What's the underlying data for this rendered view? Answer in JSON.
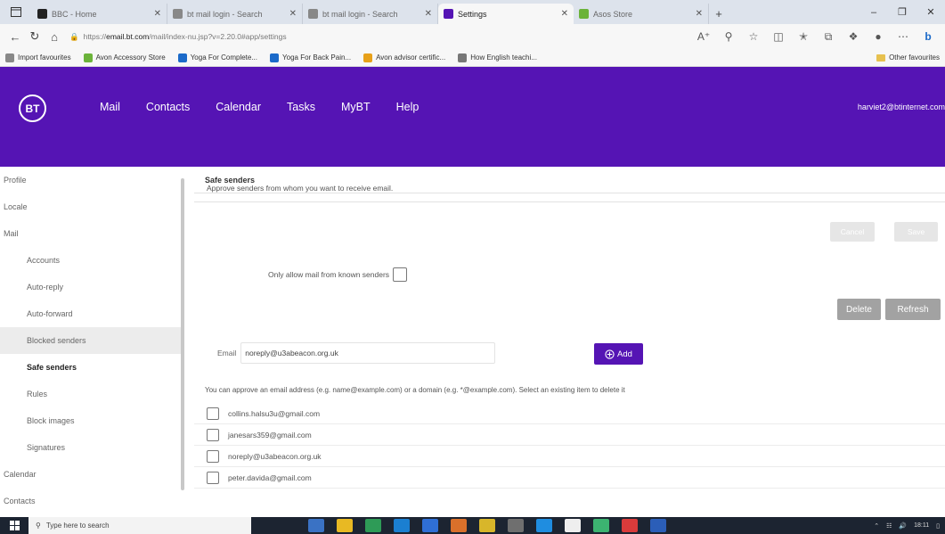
{
  "browser": {
    "tabs": [
      {
        "title": "BBC - Home",
        "fav_color": "#222222",
        "active": false
      },
      {
        "title": "bt mail login - Search",
        "fav_color": "#888888",
        "active": false
      },
      {
        "title": "bt mail login - Search",
        "fav_color": "#888888",
        "active": false
      },
      {
        "title": "Settings",
        "fav_color": "#5514b4",
        "active": true
      },
      {
        "title": "Asos Store",
        "fav_color": "#6bb33a",
        "active": false
      }
    ],
    "url_prefix": "https://",
    "url_host": "email.bt.com",
    "url_path": "/mail/index-nu.jsp?v=2.20.0#app/settings",
    "favourites": [
      {
        "label": "Import favourites",
        "color": "#888888"
      },
      {
        "label": "Avon Accessory Store",
        "color": "#6bb33a"
      },
      {
        "label": "Yoga For Complete...",
        "color": "#1b6ac9"
      },
      {
        "label": "Yoga For Back Pain...",
        "color": "#1b6ac9"
      },
      {
        "label": "Avon advisor certific...",
        "color": "#e7a019"
      },
      {
        "label": "How English teachi...",
        "color": "#777777"
      }
    ],
    "other_favourites": "Other favourites"
  },
  "bt": {
    "logo": "BT",
    "nav": [
      "Mail",
      "Contacts",
      "Calendar",
      "Tasks",
      "MyBT",
      "Help"
    ],
    "user": "harviet2@btinternet.com"
  },
  "sidebar": {
    "items": [
      {
        "label": "Profile",
        "sub": false
      },
      {
        "label": "Locale",
        "sub": false
      },
      {
        "label": "Mail",
        "sub": false
      },
      {
        "label": "Accounts",
        "sub": true
      },
      {
        "label": "Auto-reply",
        "sub": true
      },
      {
        "label": "Auto-forward",
        "sub": true
      },
      {
        "label": "Blocked senders",
        "sub": true,
        "state": "hover"
      },
      {
        "label": "Safe senders",
        "sub": true,
        "state": "selected"
      },
      {
        "label": "Rules",
        "sub": true
      },
      {
        "label": "Block images",
        "sub": true
      },
      {
        "label": "Signatures",
        "sub": true
      },
      {
        "label": "Calendar",
        "sub": false
      },
      {
        "label": "Contacts",
        "sub": false
      }
    ]
  },
  "main": {
    "title": "Safe senders",
    "description": "Approve senders from whom you want to receive email.",
    "top_buttons": [
      "Cancel",
      "Save"
    ],
    "only_known_label": "Only allow mail from known senders",
    "delete_label": "Delete",
    "refresh_label": "Refresh",
    "email_label": "Email",
    "email_value": "noreply@u3abeacon.org.uk",
    "add_label": "Add",
    "helper": "You can approve an email address (e.g. name@example.com) or a domain (e.g. *@example.com). Select an existing item to delete it",
    "senders": [
      "collins.halsu3u@gmail.com",
      "janesars359@gmail.com",
      "noreply@u3abeacon.org.uk",
      "peter.davida@gmail.com"
    ]
  },
  "taskbar": {
    "search_placeholder": "Type here to search",
    "time": "18:11",
    "apps": [
      "#3a72c4",
      "#e8b923",
      "#2e9b57",
      "#1b7fd1",
      "#2f6fd6",
      "#d9702b",
      "#d8b62a",
      "#6f6f6f",
      "#1f8de0",
      "#eeeeee",
      "#3cb371",
      "#d93b3b",
      "#2b5eb8"
    ]
  }
}
